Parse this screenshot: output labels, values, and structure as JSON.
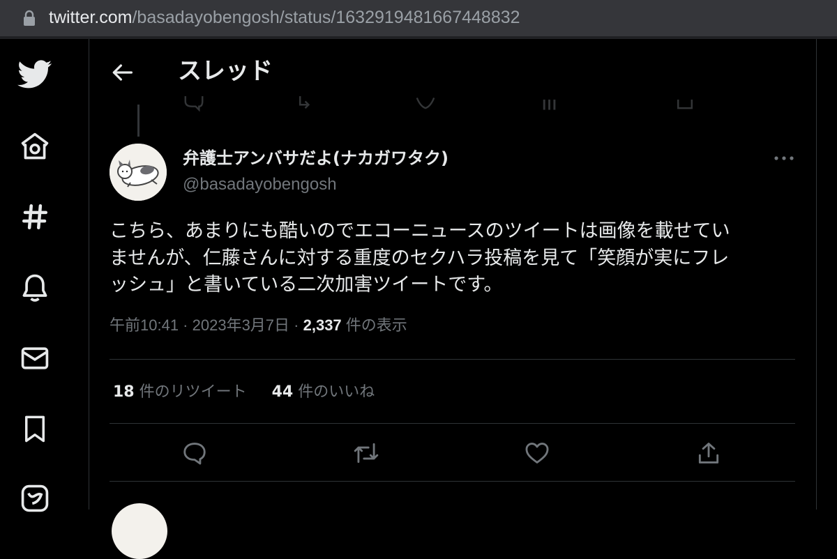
{
  "browser": {
    "url_host": "twitter.com",
    "url_path": "/basadayobengosh/status/1632919481667448832"
  },
  "sidebar": {
    "items": [
      {
        "icon": "twitter-logo-icon"
      },
      {
        "icon": "home-icon"
      },
      {
        "icon": "explore-hash-icon"
      },
      {
        "icon": "notifications-bell-icon"
      },
      {
        "icon": "messages-envelope-icon"
      },
      {
        "icon": "bookmarks-icon"
      },
      {
        "icon": "twitter-blue-icon"
      }
    ]
  },
  "header": {
    "title": "スレッド"
  },
  "tweet": {
    "display_name": "弁護士アンバサだよ(ナカガワタク)",
    "handle": "@basadayobengosh",
    "text": "こちら、あまりにも酷いのでエコーニュースのツイートは画像を載せてい\nませんが、仁藤さんに対する重度のセクハラ投稿を見て「笑顔が実にフレ\nッシュ」と書いている二次加害ツイートです。",
    "time": "午前10:41",
    "date": "2023年3月7日",
    "separator": " · ",
    "views_count": "2,337",
    "views_label": " 件の表示",
    "retweets_count": "18",
    "retweets_label": " 件のリツイート",
    "likes_count": "44",
    "likes_label": " 件のいいね"
  },
  "colors": {
    "background": "#000000",
    "text_primary": "#e7e9ea",
    "text_secondary": "#71767b",
    "border": "#2f3336",
    "urlbar": "#35363a"
  }
}
